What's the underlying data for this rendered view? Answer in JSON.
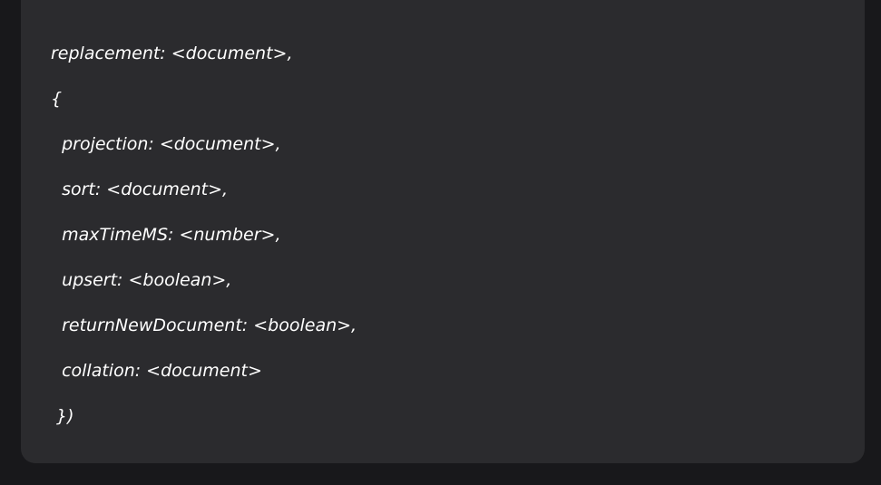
{
  "code_block": {
    "lines": [
      "replacement: <document>,",
      "{",
      "  projection: <document>,",
      "  sort: <document>,",
      "  maxTimeMS: <number>,",
      "  upsert: <boolean>,",
      "  returnNewDocument: <boolean>,",
      "  collation: <document>",
      " })"
    ]
  },
  "colors": {
    "page_background": "#18181b",
    "card_background": "#2b2b2e",
    "text": "#ffffff"
  }
}
